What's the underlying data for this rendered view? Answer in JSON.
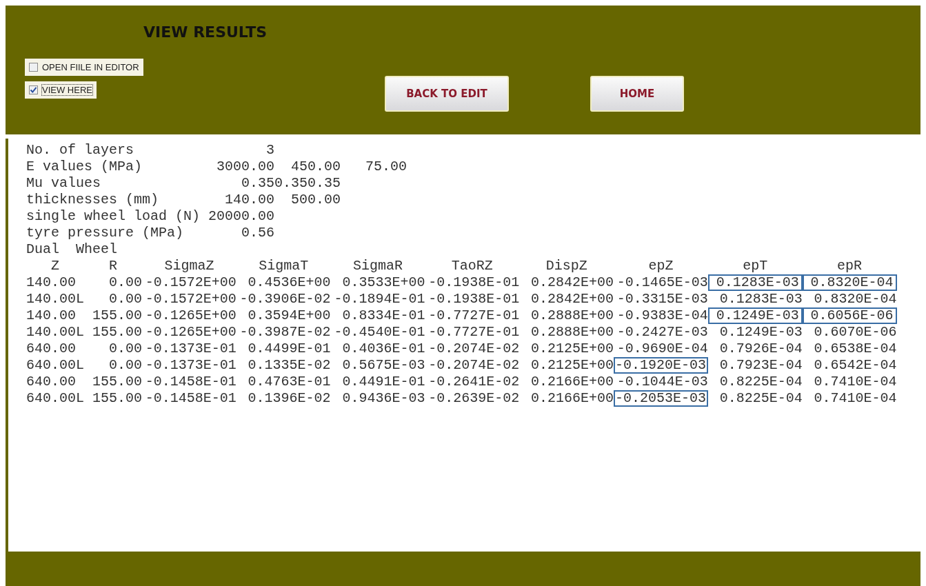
{
  "header": {
    "title": "VIEW RESULTS",
    "options": [
      {
        "label": "OPEN FIILE IN EDITOR",
        "checked": false
      },
      {
        "label": "VIEW HERE",
        "checked": true
      }
    ],
    "buttons": [
      "BACK TO EDIT",
      "HOME"
    ]
  },
  "output": {
    "lines": [
      "No. of layers                3",
      "E values (MPa)         3000.00  450.00   75.00",
      "Mu values                 0.350.350.35",
      "thicknesses (mm)        140.00  500.00",
      "single wheel load (N) 20000.00",
      "tyre pressure (MPa)       0.56",
      "Dual  Wheel"
    ],
    "columns": [
      "Z",
      "R",
      "SigmaZ",
      "SigmaT",
      "SigmaR",
      "TaoRZ",
      "DispZ",
      "epZ",
      "epT",
      "epR"
    ],
    "rows": [
      {
        "cells": [
          {
            "text": "140.00",
            "highlighted": false
          },
          {
            "text": "0.00",
            "highlighted": false
          },
          {
            "text": "-0.1572E+00",
            "highlighted": false
          },
          {
            "text": "0.4536E+00",
            "highlighted": false
          },
          {
            "text": "0.3533E+00",
            "highlighted": false
          },
          {
            "text": "-0.1938E-01",
            "highlighted": false
          },
          {
            "text": "0.2842E+00",
            "highlighted": false
          },
          {
            "text": "-0.1465E-03",
            "highlighted": false
          },
          {
            "text": "0.1283E-03",
            "highlighted": true
          },
          {
            "text": "0.8320E-04",
            "highlighted": true
          }
        ]
      },
      {
        "cells": [
          {
            "text": "140.00L",
            "highlighted": false
          },
          {
            "text": "0.00",
            "highlighted": false
          },
          {
            "text": "-0.1572E+00",
            "highlighted": false
          },
          {
            "text": "-0.3906E-02",
            "highlighted": false
          },
          {
            "text": "-0.1894E-01",
            "highlighted": false
          },
          {
            "text": "-0.1938E-01",
            "highlighted": false
          },
          {
            "text": "0.2842E+00",
            "highlighted": false
          },
          {
            "text": "-0.3315E-03",
            "highlighted": false
          },
          {
            "text": "0.1283E-03",
            "highlighted": false
          },
          {
            "text": "0.8320E-04",
            "highlighted": false
          }
        ]
      },
      {
        "cells": [
          {
            "text": "140.00",
            "highlighted": false
          },
          {
            "text": "155.00",
            "highlighted": false
          },
          {
            "text": "-0.1265E+00",
            "highlighted": false
          },
          {
            "text": "0.3594E+00",
            "highlighted": false
          },
          {
            "text": "0.8334E-01",
            "highlighted": false
          },
          {
            "text": "-0.7727E-01",
            "highlighted": false
          },
          {
            "text": "0.2888E+00",
            "highlighted": false
          },
          {
            "text": "-0.9383E-04",
            "highlighted": false
          },
          {
            "text": "0.1249E-03",
            "highlighted": true
          },
          {
            "text": "0.6056E-06",
            "highlighted": true
          }
        ]
      },
      {
        "cells": [
          {
            "text": "140.00L",
            "highlighted": false
          },
          {
            "text": "155.00",
            "highlighted": false
          },
          {
            "text": "-0.1265E+00",
            "highlighted": false
          },
          {
            "text": "-0.3987E-02",
            "highlighted": false
          },
          {
            "text": "-0.4540E-01",
            "highlighted": false
          },
          {
            "text": "-0.7727E-01",
            "highlighted": false
          },
          {
            "text": "0.2888E+00",
            "highlighted": false
          },
          {
            "text": "-0.2427E-03",
            "highlighted": false
          },
          {
            "text": "0.1249E-03",
            "highlighted": false
          },
          {
            "text": "0.6070E-06",
            "highlighted": false
          }
        ]
      },
      {
        "cells": [
          {
            "text": "640.00",
            "highlighted": false
          },
          {
            "text": "0.00",
            "highlighted": false
          },
          {
            "text": "-0.1373E-01",
            "highlighted": false
          },
          {
            "text": "0.4499E-01",
            "highlighted": false
          },
          {
            "text": "0.4036E-01",
            "highlighted": false
          },
          {
            "text": "-0.2074E-02",
            "highlighted": false
          },
          {
            "text": "0.2125E+00",
            "highlighted": false
          },
          {
            "text": "-0.9690E-04",
            "highlighted": false
          },
          {
            "text": "0.7926E-04",
            "highlighted": false
          },
          {
            "text": "0.6538E-04",
            "highlighted": false
          }
        ]
      },
      {
        "cells": [
          {
            "text": "640.00L",
            "highlighted": false
          },
          {
            "text": "0.00",
            "highlighted": false
          },
          {
            "text": "-0.1373E-01",
            "highlighted": false
          },
          {
            "text": "0.1335E-02",
            "highlighted": false
          },
          {
            "text": "0.5675E-03",
            "highlighted": false
          },
          {
            "text": "-0.2074E-02",
            "highlighted": false
          },
          {
            "text": "0.2125E+00",
            "highlighted": false
          },
          {
            "text": "-0.1920E-03",
            "highlighted": true
          },
          {
            "text": "0.7923E-04",
            "highlighted": false
          },
          {
            "text": "0.6542E-04",
            "highlighted": false
          }
        ]
      },
      {
        "cells": [
          {
            "text": "640.00",
            "highlighted": false
          },
          {
            "text": "155.00",
            "highlighted": false
          },
          {
            "text": "-0.1458E-01",
            "highlighted": false
          },
          {
            "text": "0.4763E-01",
            "highlighted": false
          },
          {
            "text": "0.4491E-01",
            "highlighted": false
          },
          {
            "text": "-0.2641E-02",
            "highlighted": false
          },
          {
            "text": "0.2166E+00",
            "highlighted": false
          },
          {
            "text": "-0.1044E-03",
            "highlighted": false
          },
          {
            "text": "0.8225E-04",
            "highlighted": false
          },
          {
            "text": "0.7410E-04",
            "highlighted": false
          }
        ]
      },
      {
        "cells": [
          {
            "text": "640.00L",
            "highlighted": false
          },
          {
            "text": "155.00",
            "highlighted": false
          },
          {
            "text": "-0.1458E-01",
            "highlighted": false
          },
          {
            "text": "0.1396E-02",
            "highlighted": false
          },
          {
            "text": "0.9436E-03",
            "highlighted": false
          },
          {
            "text": "-0.2639E-02",
            "highlighted": false
          },
          {
            "text": "0.2166E+00",
            "highlighted": false
          },
          {
            "text": "-0.2053E-03",
            "highlighted": true
          },
          {
            "text": "0.8225E-04",
            "highlighted": false
          },
          {
            "text": "0.7410E-04",
            "highlighted": false
          }
        ]
      }
    ]
  }
}
